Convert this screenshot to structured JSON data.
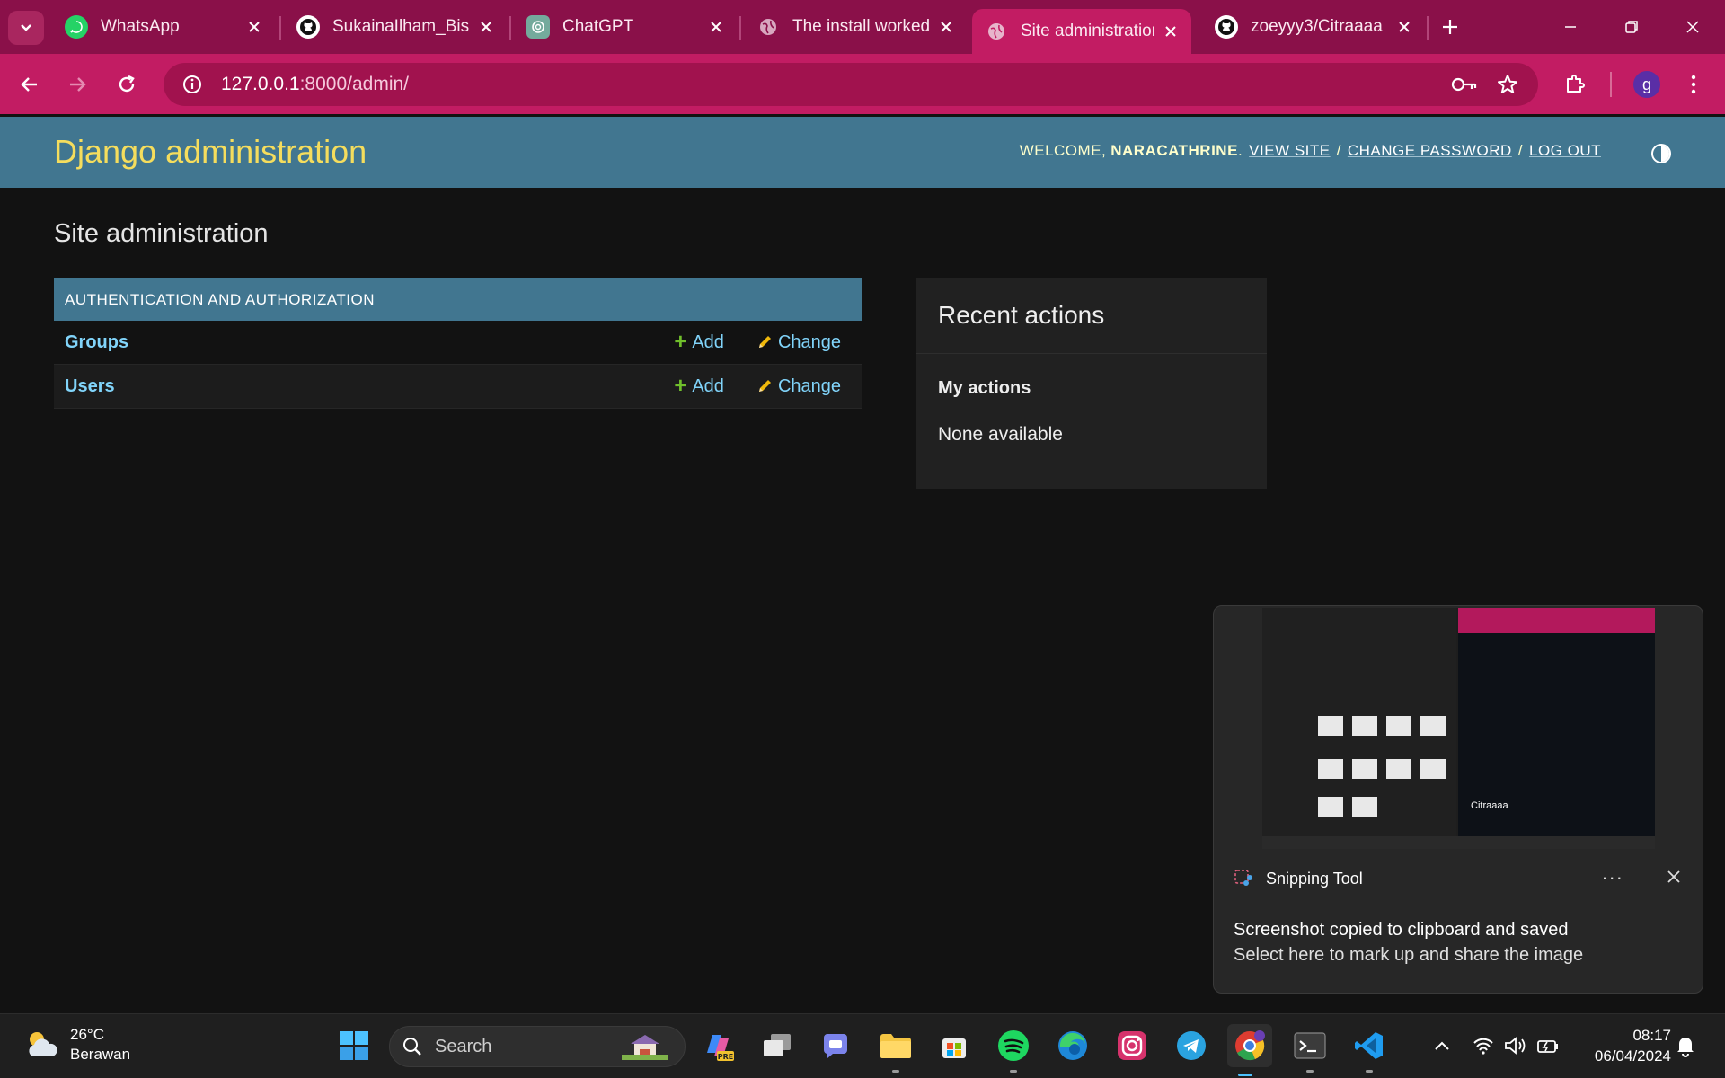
{
  "browser": {
    "tabs": [
      {
        "title": "WhatsApp",
        "icon": "whatsapp-icon"
      },
      {
        "title": "SukainaIlham_Bisd",
        "icon": "github-icon"
      },
      {
        "title": "ChatGPT",
        "icon": "chatgpt-icon"
      },
      {
        "title": "The install worked",
        "icon": "globe-icon"
      },
      {
        "title": "Site administration",
        "icon": "globe-icon",
        "active": true
      },
      {
        "title": "zoeyyy3/Citraaaa",
        "icon": "github-icon"
      }
    ],
    "url_host": "127.0.0.1",
    "url_rest": ":8000/admin/",
    "profile_initial": "g",
    "accent_color": "#c21c63"
  },
  "django": {
    "branding": "Django administration",
    "welcome": "Welcome,",
    "username": "NARACATHRINE",
    "after_user": ".",
    "view_site": "View site",
    "change_password": "Change password",
    "log_out": "Log out",
    "slash": "/",
    "page_title": "Site administration",
    "module_caption": "Authentication and Authorization",
    "models": [
      {
        "name": "Groups",
        "add": "Add",
        "change": "Change"
      },
      {
        "name": "Users",
        "add": "Add",
        "change": "Change"
      }
    ],
    "recent_actions": "Recent actions",
    "my_actions": "My actions",
    "none_available": "None available",
    "header_color": "#417690",
    "branding_color": "#f5dd5d"
  },
  "toast": {
    "app": "Snipping Tool",
    "more": "...",
    "title": "Screenshot copied to clipboard and saved",
    "body": "Select here to mark up and share the image",
    "thumb_label": "Citraaaa"
  },
  "taskbar": {
    "temperature": "26°C",
    "weather": "Berawan",
    "search_placeholder": "Search",
    "time": "08:17",
    "date": "06/04/2024"
  }
}
